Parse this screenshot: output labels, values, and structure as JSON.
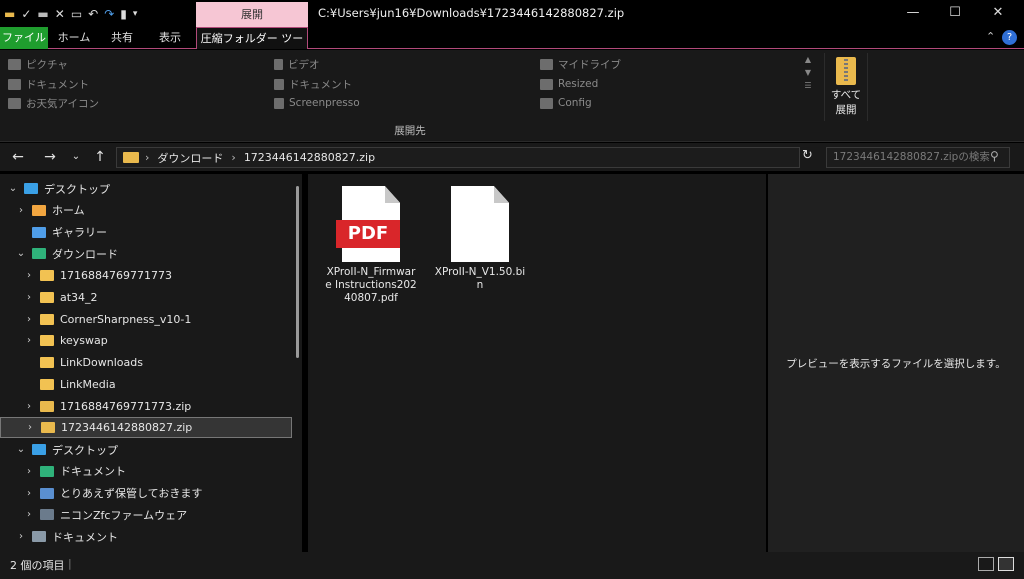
{
  "titlebar": {
    "context_tab": "展開",
    "path": "C:¥Users¥jun16¥Downloads¥1723446142880827.zip",
    "minimize": "—",
    "maximize": "☐",
    "close": "✕"
  },
  "ribbon_tabs": {
    "file": "ファイル",
    "home": "ホーム",
    "share": "共有",
    "view": "表示",
    "zip_tools": "圧縮フォルダー ツール"
  },
  "ribbon": {
    "destinations": [
      [
        "ピクチャ",
        "ビデオ",
        "マイドライブ"
      ],
      [
        "ドキュメント",
        "ドキュメント",
        "Resized"
      ],
      [
        "お天気アイコン",
        "Screenpresso",
        "Config"
      ]
    ],
    "extract_all_line1": "すべて",
    "extract_all_line2": "展開",
    "group_label": "展開先"
  },
  "address": {
    "crumb1": "ダウンロード",
    "crumb2": "1723446142880827.zip",
    "search_placeholder": "1723446142880827.zipの検索"
  },
  "tree": [
    {
      "label": "デスクトップ",
      "chev": "⌄",
      "color": "#3aa0e6",
      "indent": 6
    },
    {
      "label": "ホーム",
      "chev": "›",
      "color": "#f2a640",
      "indent": 14
    },
    {
      "label": "ギャラリー",
      "chev": "",
      "color": "#4f9de8",
      "indent": 14
    },
    {
      "label": "ダウンロード",
      "chev": "⌄",
      "color": "#2fb27a",
      "indent": 14
    },
    {
      "label": "1716884769771773",
      "chev": "›",
      "color": "#f2c252",
      "indent": 22
    },
    {
      "label": "at34_2",
      "chev": "›",
      "color": "#f2c252",
      "indent": 22
    },
    {
      "label": "CornerSharpness_v10-1",
      "chev": "›",
      "color": "#f2c252",
      "indent": 22
    },
    {
      "label": "keyswap",
      "chev": "›",
      "color": "#f2c252",
      "indent": 22
    },
    {
      "label": "LinkDownloads",
      "chev": "",
      "color": "#f2c252",
      "indent": 22
    },
    {
      "label": "LinkMedia",
      "chev": "",
      "color": "#f2c252",
      "indent": 22
    },
    {
      "label": "1716884769771773.zip",
      "chev": "›",
      "color": "#e9b94d",
      "indent": 22
    },
    {
      "label": "1723446142880827.zip",
      "chev": "›",
      "color": "#e9b94d",
      "indent": 22
    },
    {
      "label": "デスクトップ",
      "chev": "⌄",
      "color": "#3aa0e6",
      "indent": 14
    },
    {
      "label": "ドキュメント",
      "chev": "›",
      "color": "#2fb27a",
      "indent": 22
    },
    {
      "label": "とりあえず保管しておきます",
      "chev": "›",
      "color": "#5a8fd0",
      "indent": 22
    },
    {
      "label": "ニコンZfcファームウェア",
      "chev": "›",
      "color": "#6b7b8c",
      "indent": 22
    },
    {
      "label": "ドキュメント",
      "chev": "›",
      "color": "#8a9aa8",
      "indent": 14
    }
  ],
  "files": [
    {
      "name": "XProII-N_Firmware Instructions20240807.pdf",
      "type": "pdf",
      "badge": "PDF"
    },
    {
      "name": "XProII-N_V1.50.bin",
      "type": "bin"
    }
  ],
  "preview": {
    "message": "プレビューを表示するファイルを選択します。"
  },
  "status": {
    "count": "2 個の項目",
    "sep": "|"
  },
  "colors": {
    "context_tab": "#f6c6d4",
    "file_tab": "#1f9d2e",
    "pdf_red": "#d9262a",
    "folder": "#f2c252"
  }
}
